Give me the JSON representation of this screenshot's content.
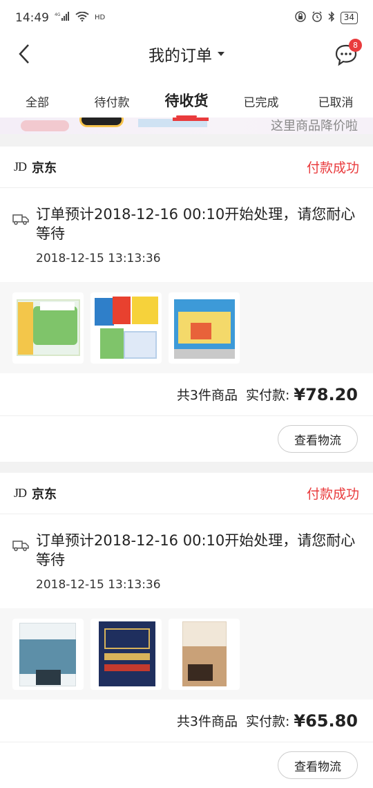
{
  "status_bar": {
    "time": "14:49",
    "network": "4G",
    "hd": "HD",
    "battery": "34"
  },
  "header": {
    "title": "我的订单",
    "message_badge": "8"
  },
  "tabs": [
    {
      "label": "全部",
      "active": false
    },
    {
      "label": "待付款",
      "active": false
    },
    {
      "label": "待收货",
      "active": true
    },
    {
      "label": "已完成",
      "active": false
    },
    {
      "label": "已取消",
      "active": false
    }
  ],
  "banner": {
    "text": "这里商品降价啦"
  },
  "orders": [
    {
      "shop_logo": "JD",
      "shop_name": "京东",
      "status": "付款成功",
      "info_text": "订单预计2018-12-16 00:10开始处理，请您耐心等待",
      "info_time": "2018-12-15 13:13:36",
      "item_count_label": "共3件商品",
      "paid_label": "实付款:",
      "price": "¥78.20",
      "action_label": "查看物流"
    },
    {
      "shop_logo": "JD",
      "shop_name": "京东",
      "status": "付款成功",
      "info_text": "订单预计2018-12-16 00:10开始处理，请您耐心等待",
      "info_time": "2018-12-15 13:13:36",
      "item_count_label": "共3件商品",
      "paid_label": "实付款:",
      "price": "¥65.80",
      "action_label": "查看物流"
    }
  ],
  "colors": {
    "accent": "#e93b3d",
    "background": "#f2f2f2"
  }
}
